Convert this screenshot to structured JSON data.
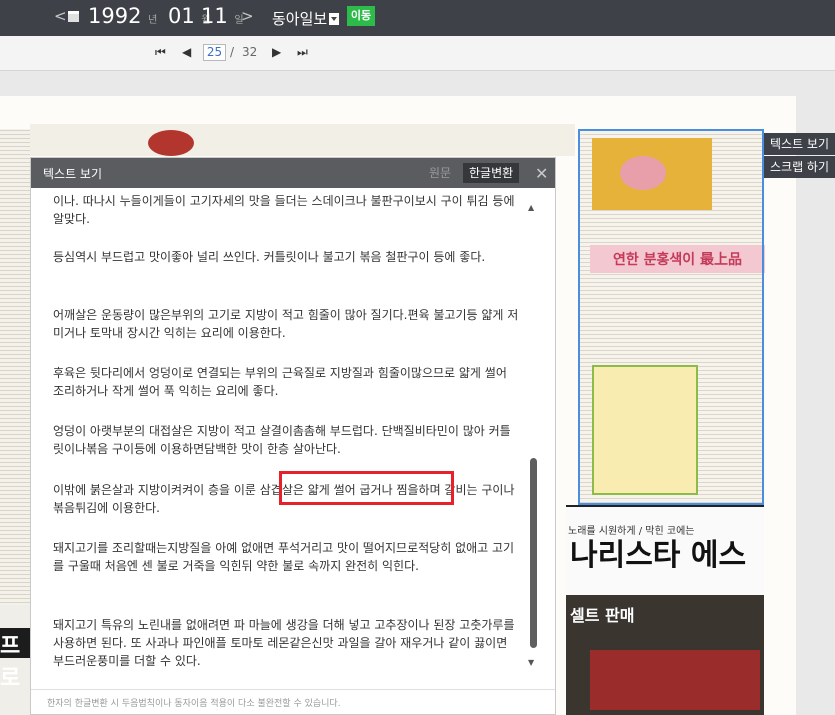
{
  "topbar": {
    "prev_glyph": "<",
    "next_glyph": ">",
    "year": "1992",
    "year_unit": "년",
    "month": "01",
    "month_unit": "월",
    "day": "11",
    "day_unit": "일",
    "newspaper": "동아일보",
    "go_label": "이동"
  },
  "pager": {
    "first": "⏮",
    "prev": "◀",
    "current": "25",
    "separator": "/",
    "total": "32",
    "next": "▶",
    "last": "⏭"
  },
  "side_buttons": {
    "text_view": "텍스트 보기",
    "scrap": "스크랩 하기"
  },
  "panel": {
    "title": "텍스트 보기",
    "original_tab": "원문",
    "converted_tab": "한글변환",
    "paragraphs": [
      "이나. 따나시 누들이게들이 고기자세의 맛을 들더는 스데이크나 불판구이보시 구이 튀김 등에 알맞다.",
      "등심역시 부드럽고 맛이좋아 널리 쓰인다. 커틀릿이나 불고기 볶음 철판구이 등에 좋다.",
      "어깨살은 운동량이 많은부위의 고기로 지방이 적고 힘줄이 많아 질기다.편육 불고기등 얇게 저미거나 토막내 장시간 익히는 요리에 이용한다.",
      "후육은 뒷다리에서 엉덩이로 연결되는 부위의 근육질로 지방질과 힘줄이많으므로 얇게 썰어 조리하거나 작게 썰어 푹 익히는 요리에 좋다.",
      "엉덩이 아랫부분의 대접살은 지방이 적고 살결이촘촘해 부드럽다. 단백질비타민이 많아 커틀릿이나볶음 구이등에 이용하면담백한 맛이 한층 살아난다.",
      "이밖에 붉은살과 지방이켜켜이 층을 이룬 삼겹살은 얇게 썰어 굽거나 찜을하며 갈비는 구이나 볶음튀김에 이용한다.",
      "돼지고기를 조리할때는지방질을 아예 없애면 푸석거리고 맛이 떨어지므로적당히 없애고 고기를 구울때 처음엔 센 불로 거죽을 익힌뒤 약한 불로 속까지 완전히 익힌다.",
      "돼지고기 특유의 노린내를 없애려면 파 마늘에 생강을 더해 넣고 고추장이나 된장 고춧가루를 사용하면 된다. 또 사과나 파인애플 토마토 레몬같은신맛 과일을 갈아 재우거나 같이 끓이면 부드러운풍미를 더할 수 있다."
    ],
    "footer_note": "한자의 한글변환 시 두음법칙이나 동자이음 적용이 다소 불완전할 수 있습니다."
  },
  "newspaper_page": {
    "headline_ad": "연한 분홍색이 最上品",
    "ad_brand": "나리스타 에스",
    "ad_slogan": "노래를 시원하게 / 막힌 코에는",
    "ad_sale": "셀트 판매",
    "left_fragment": "프로"
  },
  "colors": {
    "topbar_bg": "#3e4147",
    "go_button": "#2dbb4a",
    "highlight_border": "#e8202a",
    "selection_box": "#4a8ee0"
  },
  "icons": {
    "calendar": "calendar-icon",
    "close": "close-icon",
    "scroll_up": "scroll-up-icon",
    "scroll_down": "scroll-down-icon"
  }
}
